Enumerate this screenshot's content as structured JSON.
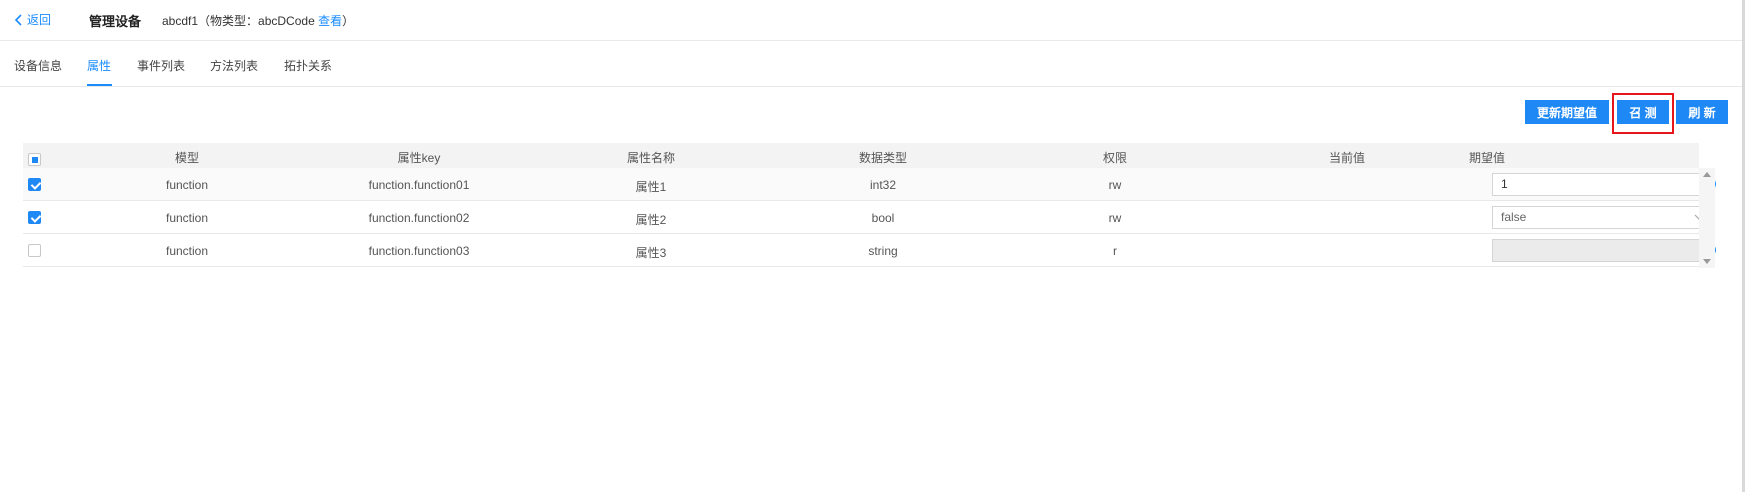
{
  "header": {
    "back_label": "返回",
    "title": "管理设备",
    "device_name": "abcdf1",
    "type_prefix": "（物类型：",
    "type_name": "abcDCode",
    "view_link": "查看",
    "type_suffix": "）"
  },
  "tabs": [
    {
      "label": "设备信息",
      "active": false
    },
    {
      "label": "属性",
      "active": true
    },
    {
      "label": "事件列表",
      "active": false
    },
    {
      "label": "方法列表",
      "active": false
    },
    {
      "label": "拓扑关系",
      "active": false
    }
  ],
  "toolbar": {
    "update_expected_label": "更新期望值",
    "summon_label": "召 测",
    "refresh_label": "刷 新"
  },
  "table": {
    "columns": [
      "模型",
      "属性key",
      "属性名称",
      "数据类型",
      "权限",
      "当前值",
      "期望值"
    ],
    "rows": [
      {
        "checked": true,
        "model": "function",
        "key": "function.function01",
        "name": "属性1",
        "type": "int32",
        "perm": "rw",
        "current": "",
        "expected": "1",
        "expected_control": "input"
      },
      {
        "checked": true,
        "model": "function",
        "key": "function.function02",
        "name": "属性2",
        "type": "bool",
        "perm": "rw",
        "current": "",
        "expected": "false",
        "expected_control": "select"
      },
      {
        "checked": false,
        "model": "function",
        "key": "function.function03",
        "name": "属性3",
        "type": "string",
        "perm": "r",
        "current": "",
        "expected": "",
        "expected_control": "disabled-input"
      }
    ]
  },
  "colors": {
    "accent": "#1a8cff",
    "button": "#1e88f5",
    "highlight": "#e8161b"
  },
  "icons": {
    "back": "chevron-left-icon",
    "help": "question-circle-icon",
    "select": "chevron-down-icon"
  }
}
